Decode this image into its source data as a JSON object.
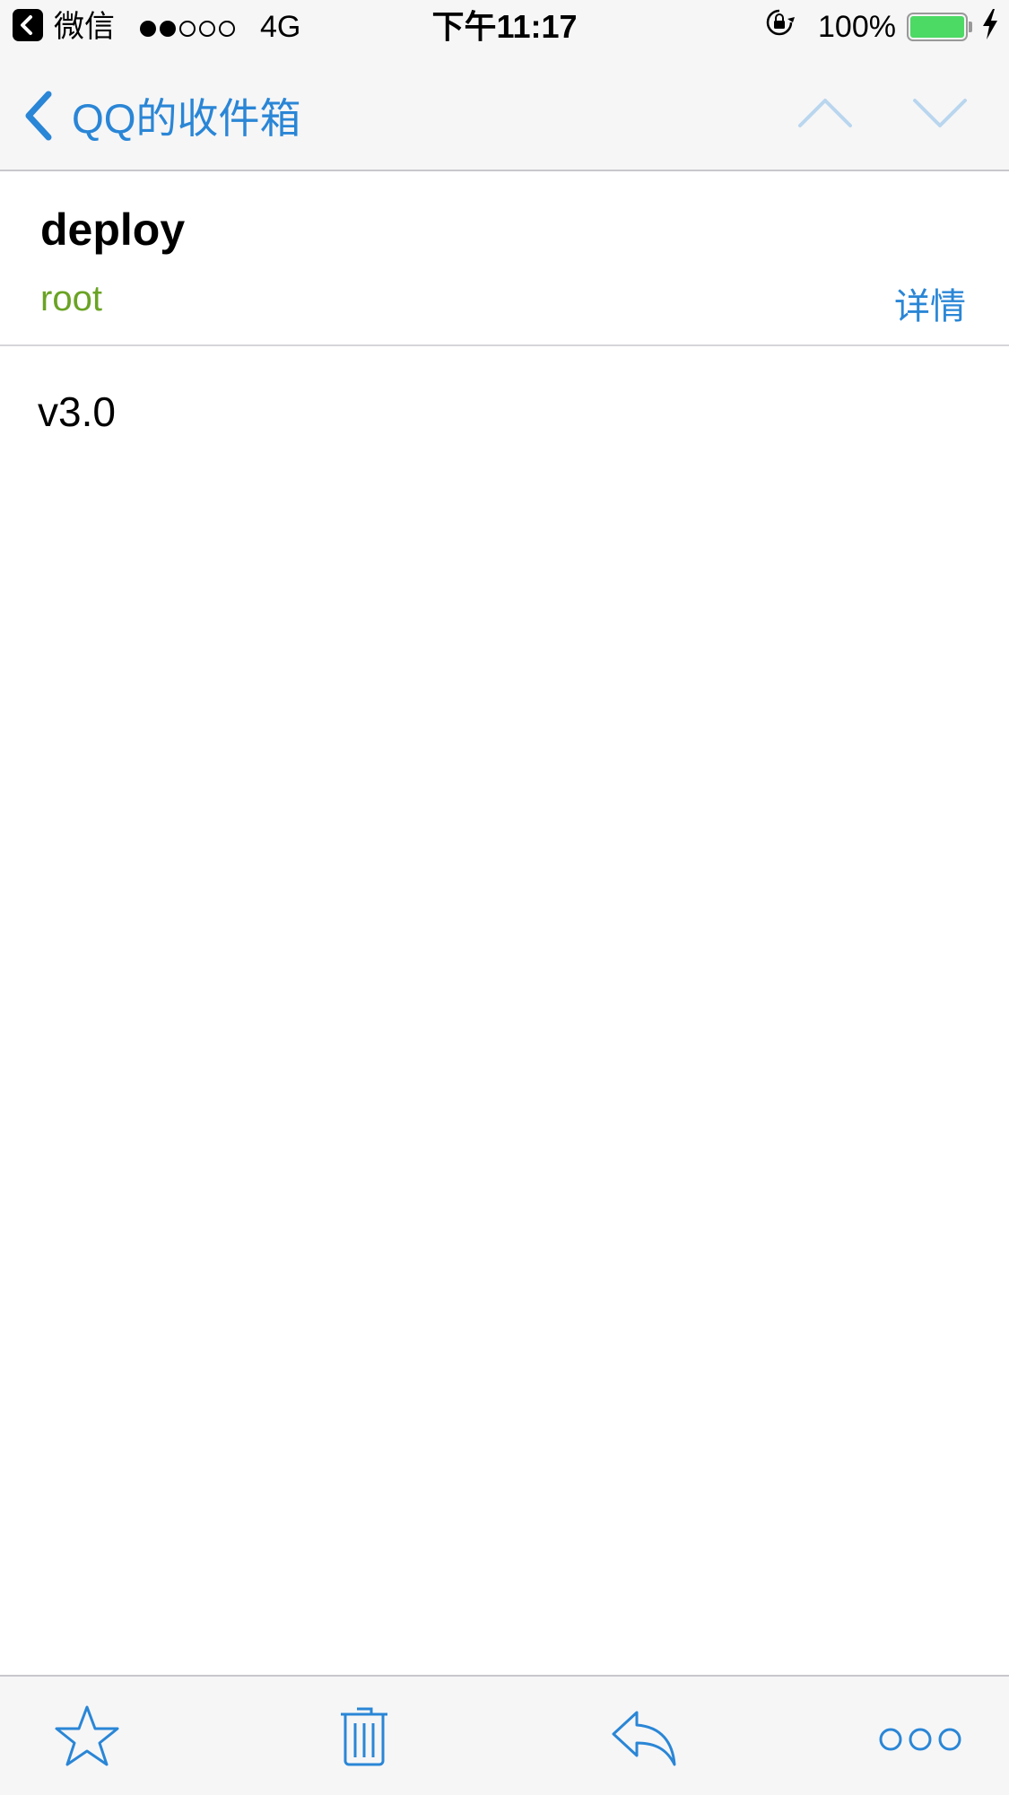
{
  "status_bar": {
    "app_name": "微信",
    "network": "4G",
    "time": "下午11:17",
    "battery_percent": "100%",
    "battery_level": 1.0,
    "signal_strength": 2,
    "signal_max": 5
  },
  "nav": {
    "back_label": "QQ的收件箱",
    "accent_color": "#2a86d6"
  },
  "mail": {
    "subject": "deploy",
    "sender": "root",
    "sender_color": "#6aa324",
    "details_label": "详情",
    "body": "v3.0"
  },
  "toolbar": {
    "icons": [
      "star-icon",
      "trash-icon",
      "reply-icon",
      "more-icon"
    ]
  }
}
